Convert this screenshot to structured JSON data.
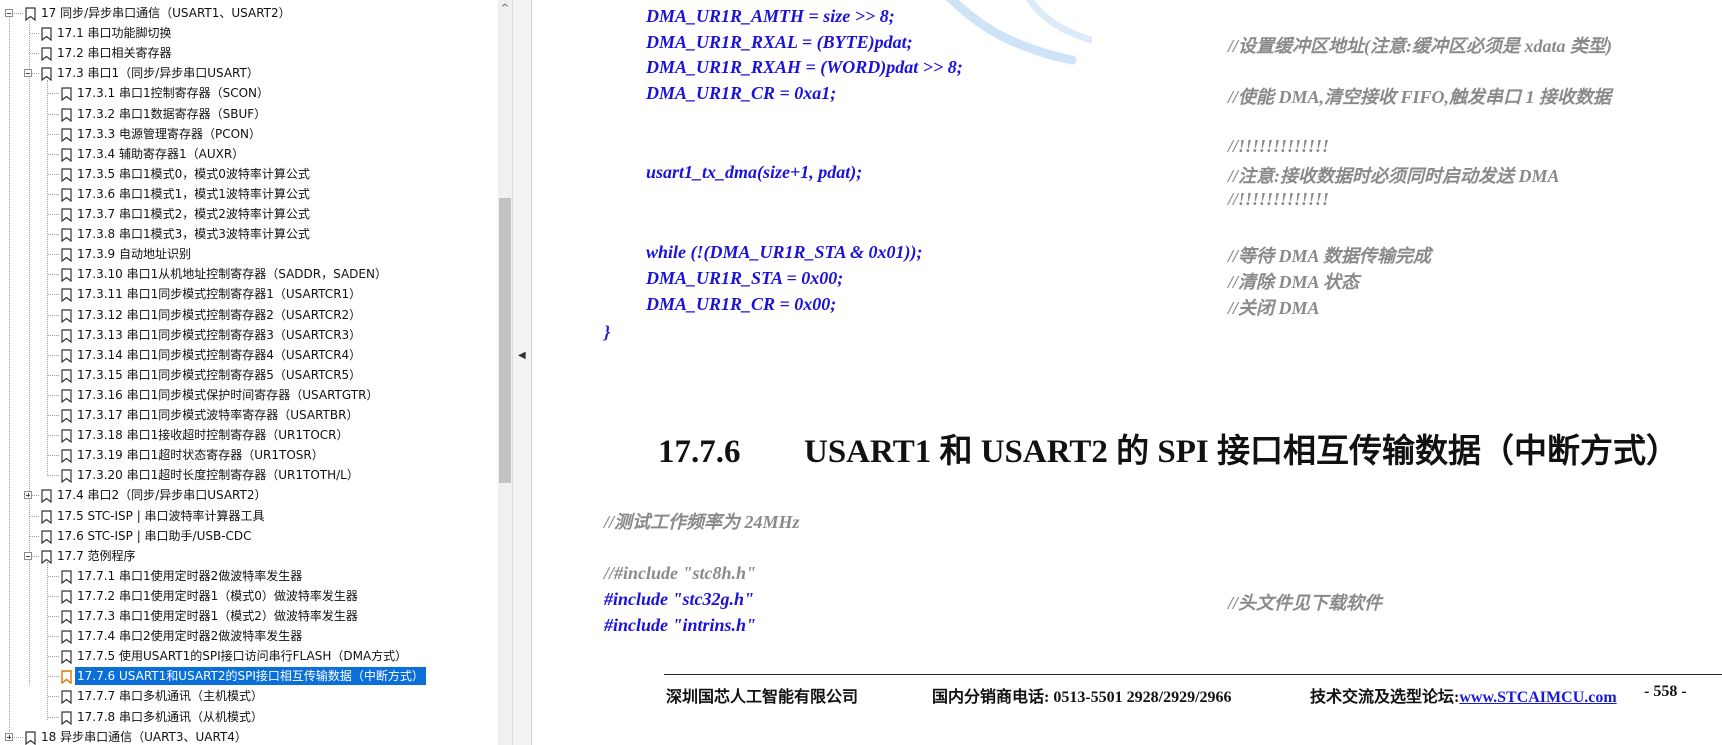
{
  "bookmarks": [
    {
      "label": "17 同步/异步串口通信（USART1、USART2）",
      "level": 0,
      "toggle": "minus"
    },
    {
      "label": "17.1 串口功能脚切换",
      "level": 1
    },
    {
      "label": "17.2 串口相关寄存器",
      "level": 1
    },
    {
      "label": "17.3 串口1（同步/异步串口USART）",
      "level": 1,
      "toggle": "minus"
    },
    {
      "label": "17.3.1 串口1控制寄存器（SCON）",
      "level": 2
    },
    {
      "label": "17.3.2 串口1数据寄存器（SBUF）",
      "level": 2
    },
    {
      "label": "17.3.3 电源管理寄存器（PCON）",
      "level": 2
    },
    {
      "label": "17.3.4 辅助寄存器1（AUXR）",
      "level": 2
    },
    {
      "label": "17.3.5 串口1模式0，模式0波特率计算公式",
      "level": 2
    },
    {
      "label": "17.3.6 串口1模式1，模式1波特率计算公式",
      "level": 2
    },
    {
      "label": "17.3.7 串口1模式2，模式2波特率计算公式",
      "level": 2
    },
    {
      "label": "17.3.8 串口1模式3，模式3波特率计算公式",
      "level": 2
    },
    {
      "label": "17.3.9 自动地址识别",
      "level": 2
    },
    {
      "label": "17.3.10 串口1从机地址控制寄存器（SADDR，SADEN）",
      "level": 2
    },
    {
      "label": "17.3.11 串口1同步模式控制寄存器1（USARTCR1）",
      "level": 2
    },
    {
      "label": "17.3.12 串口1同步模式控制寄存器2（USARTCR2）",
      "level": 2
    },
    {
      "label": "17.3.13 串口1同步模式控制寄存器3（USARTCR3）",
      "level": 2
    },
    {
      "label": "17.3.14 串口1同步模式控制寄存器4（USARTCR4）",
      "level": 2
    },
    {
      "label": "17.3.15 串口1同步模式控制寄存器5（USARTCR5）",
      "level": 2
    },
    {
      "label": "17.3.16 串口1同步模式保护时间寄存器（USARTGTR）",
      "level": 2
    },
    {
      "label": "17.3.17 串口1同步模式波特率寄存器（USARTBR）",
      "level": 2
    },
    {
      "label": "17.3.18 串口1接收超时控制寄存器（UR1TOCR）",
      "level": 2
    },
    {
      "label": "17.3.19 串口1超时状态寄存器（UR1TOSR）",
      "level": 2
    },
    {
      "label": "17.3.20 串口1超时长度控制寄存器（UR1TOTH/L）",
      "level": 2
    },
    {
      "label": "17.4 串口2（同步/异步串口USART2）",
      "level": 1,
      "toggle": "plus"
    },
    {
      "label": "17.5 STC-ISP | 串口波特率计算器工具",
      "level": 1
    },
    {
      "label": "17.6 STC-ISP | 串口助手/USB-CDC",
      "level": 1
    },
    {
      "label": "17.7 范例程序",
      "level": 1,
      "toggle": "minus"
    },
    {
      "label": "17.7.1 串口1使用定时器2做波特率发生器",
      "level": 2
    },
    {
      "label": "17.7.2 串口1使用定时器1（模式0）做波特率发生器",
      "level": 2
    },
    {
      "label": "17.7.3 串口1使用定时器1（模式2）做波特率发生器",
      "level": 2
    },
    {
      "label": "17.7.4 串口2使用定时器2做波特率发生器",
      "level": 2
    },
    {
      "label": "17.7.5 使用USART1的SPI接口访问串行FLASH（DMA方式）",
      "level": 2
    },
    {
      "label": "17.7.6 USART1和USART2的SPI接口相互传输数据（中断方式）",
      "level": 2,
      "selected": true
    },
    {
      "label": "17.7.7 串口多机通讯（主机模式）",
      "level": 2
    },
    {
      "label": "17.7.8 串口多机通讯（从机模式）",
      "level": 2
    },
    {
      "label": "18 异步串口通信（UART3、UART4）",
      "level": 0,
      "toggle": "plus"
    }
  ],
  "document": {
    "code_lines": [
      {
        "code": "DMA_UR1R_AMTH = size >> 8;",
        "comment": ""
      },
      {
        "code": "DMA_UR1R_RXAL = (BYTE)pdat;",
        "comment": "//设置缓冲区地址(注意:缓冲区必须是 xdata 类型)"
      },
      {
        "code": "DMA_UR1R_RXAH = (WORD)pdat >> 8;",
        "comment": ""
      },
      {
        "code": "DMA_UR1R_CR = 0xa1;",
        "comment": "//使能 DMA,清空接收 FIFO,触发串口 1 接收数据"
      },
      {
        "code": "",
        "comment": "//!!!!!!!!!!!!!"
      },
      {
        "code": "usart1_tx_dma(size+1, pdat);",
        "comment": "//注意:接收数据时必须同时启动发送 DMA"
      },
      {
        "code": "",
        "comment": "//!!!!!!!!!!!!!"
      },
      {
        "code": "while (!(DMA_UR1R_STA & 0x01));",
        "comment": "//等待 DMA 数据传输完成"
      },
      {
        "code": "DMA_UR1R_STA = 0x00;",
        "comment": "//清除 DMA 状态"
      },
      {
        "code": "DMA_UR1R_CR = 0x00;",
        "comment": "//关闭 DMA"
      }
    ],
    "closing_brace": "}",
    "section_number": "17.7.6",
    "section_title": "USART1 和 USART2 的 SPI 接口相互传输数据（中断方式）",
    "freq_comment": "//测试工作频率为 24MHz",
    "include_commented": "//#include \"stc8h.h\"",
    "include_stc32g": "#include \"stc32g.h\"",
    "include_stc32g_comment": "//头文件见下载软件",
    "include_intrins": "#include \"intrins.h\"",
    "footer": {
      "company": "深圳国芯人工智能有限公司",
      "phone": "国内分销商电话: 0513-5501 2928/2929/2966",
      "forum_label": "技术交流及选型论坛:",
      "forum_link": "www.STCAIMCU.com",
      "page": "- 558 -"
    }
  },
  "icons": {
    "bookmark": "bookmark-icon",
    "scroll_up": "chevron-up-icon",
    "collapse": "collapse-left-icon"
  },
  "colors": {
    "code": "#1b12d8",
    "comment": "#8a8a8a",
    "selection": "#0a6fd8",
    "link": "#1a1ad6"
  }
}
